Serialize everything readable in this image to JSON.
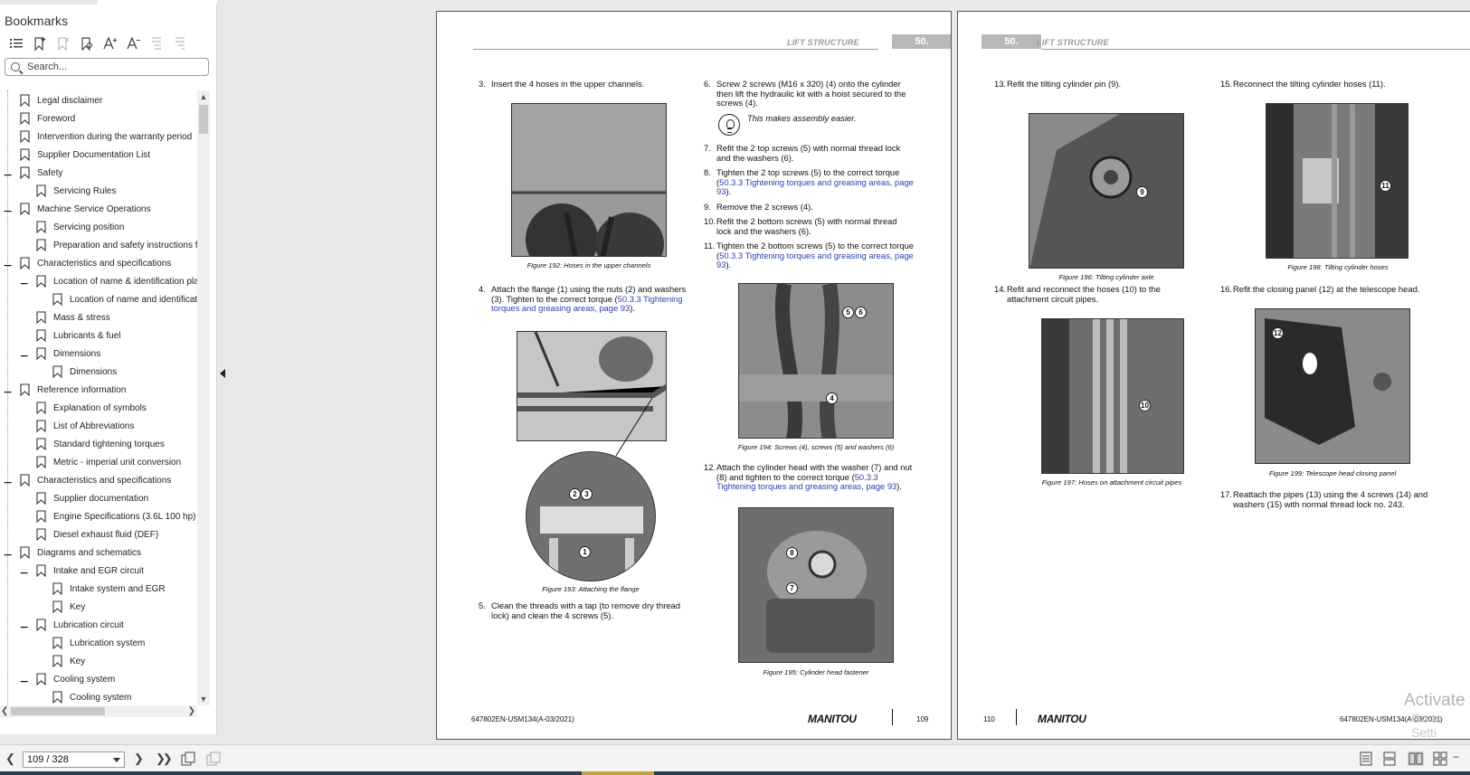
{
  "sidebar": {
    "title": "Bookmarks",
    "search_placeholder": "Search...",
    "tools": [
      "bookmark-options-icon",
      "add-bookmark-icon",
      "delete-bookmark-icon",
      "bookmark-properties-icon",
      "expand-text-icon",
      "shrink-text-icon",
      "expand-all-icon",
      "collapse-all-icon"
    ],
    "items": [
      {
        "label": "Legal disclaimer",
        "level": 0,
        "toggle": ""
      },
      {
        "label": "Foreword",
        "level": 0,
        "toggle": ""
      },
      {
        "label": "Intervention during the warranty period",
        "level": 0,
        "toggle": ""
      },
      {
        "label": "Supplier Documentation List",
        "level": 0,
        "toggle": ""
      },
      {
        "label": "Safety",
        "level": 0,
        "toggle": "−"
      },
      {
        "label": "Servicing Rules",
        "level": 1,
        "toggle": ""
      },
      {
        "label": "Machine Service Operations",
        "level": 0,
        "toggle": "−"
      },
      {
        "label": "Servicing position",
        "level": 1,
        "toggle": ""
      },
      {
        "label": "Preparation and safety instructions for",
        "level": 1,
        "toggle": ""
      },
      {
        "label": "Characteristics and specifications",
        "level": 0,
        "toggle": "−"
      },
      {
        "label": "Location of name & identification pla",
        "level": 1,
        "toggle": "−"
      },
      {
        "label": "Location of name and identificati",
        "level": 2,
        "toggle": ""
      },
      {
        "label": "Mass & stress",
        "level": 1,
        "toggle": ""
      },
      {
        "label": "Lubricants & fuel",
        "level": 1,
        "toggle": ""
      },
      {
        "label": "Dimensions",
        "level": 1,
        "toggle": "−"
      },
      {
        "label": "Dimensions",
        "level": 2,
        "toggle": ""
      },
      {
        "label": "Reference information",
        "level": 0,
        "toggle": "−"
      },
      {
        "label": "Explanation of symbols",
        "level": 1,
        "toggle": ""
      },
      {
        "label": "List of Abbreviations",
        "level": 1,
        "toggle": ""
      },
      {
        "label": "Standard tightening torques",
        "level": 1,
        "toggle": ""
      },
      {
        "label": "Metric - imperial unit conversion",
        "level": 1,
        "toggle": ""
      },
      {
        "label": "Characteristics and specifications",
        "level": 0,
        "toggle": "−"
      },
      {
        "label": "Supplier documentation",
        "level": 1,
        "toggle": ""
      },
      {
        "label": "Engine Specifications (3.6L 100 hp)",
        "level": 1,
        "toggle": ""
      },
      {
        "label": "Diesel exhaust fluid (DEF)",
        "level": 1,
        "toggle": ""
      },
      {
        "label": "Diagrams and schematics",
        "level": 0,
        "toggle": "−"
      },
      {
        "label": "Intake and EGR circuit",
        "level": 1,
        "toggle": "−"
      },
      {
        "label": "Intake system and EGR",
        "level": 2,
        "toggle": ""
      },
      {
        "label": "Key",
        "level": 2,
        "toggle": ""
      },
      {
        "label": "Lubrication circuit",
        "level": 1,
        "toggle": "−"
      },
      {
        "label": "Lubrication system",
        "level": 2,
        "toggle": ""
      },
      {
        "label": "Key",
        "level": 2,
        "toggle": ""
      },
      {
        "label": "Cooling system",
        "level": 1,
        "toggle": "−"
      },
      {
        "label": "Cooling system",
        "level": 2,
        "toggle": ""
      },
      {
        "label": "Key",
        "level": 2,
        "toggle": ""
      }
    ]
  },
  "page_left": {
    "header_section": "LIFT STRUCTURE",
    "header_number": "50.",
    "steps": {
      "s3_num": "3.",
      "s3_text": "Insert the 4 hoses in the upper channels.",
      "s4_num": "4.",
      "s4_text": "Attach the flange (1) using the nuts (2) and washers (3). Tighten to the correct torque (",
      "s4_link": "50.3.3 Tightening torques and greasing areas, page 93",
      "s4_tail": ").",
      "s5_num": "5.",
      "s5_text": "Clean the threads with a tap (to remove dry thread lock) and clean the 4 screws (5).",
      "s6_num": "6.",
      "s6_text": "Screw 2 screws (M16 x 320) (4) onto the cylinder then lift the hydraulic kit with a hoist secured to the screws (4).",
      "s6_note": "This makes assembly easier.",
      "s7_num": "7.",
      "s7_text": "Refit the 2 top screws (5) with normal thread lock and the washers (6).",
      "s8_num": "8.",
      "s8_text": "Tighten the 2 top screws (5) to the correct torque (",
      "s8_link": "50.3.3 Tightening torques and greasing areas, page 93",
      "s8_tail": ").",
      "s9_num": "9.",
      "s9_text": "Remove the 2 screws (4).",
      "s10_num": "10.",
      "s10_text": "Refit the 2 bottom screws (5) with normal thread lock and the washers (6).",
      "s11_num": "11.",
      "s11_text": "Tighten the 2 bottom screws (5) to the correct torque (",
      "s11_link": "50.3.3 Tightening torques and greasing areas, page 93",
      "s11_tail": ").",
      "s12_num": "12.",
      "s12_text": "Attach the cylinder head with the washer (7) and nut (8) and tighten to the correct torque (",
      "s12_link": "50.3.3 Tightening torques and greasing areas, page 93",
      "s12_tail": ")."
    },
    "captions": {
      "f192": "Figure 192: Hoses in the upper channels",
      "f193": "Figure 193: Attaching the flange",
      "f194": "Figure 194: Screws (4), screws (5) and washers (6)",
      "f195": "Figure 195: Cylinder head fastener"
    },
    "callouts": {
      "c1": "1",
      "c2": "2",
      "c3": "3",
      "c4": "4",
      "c5": "5",
      "c6": "6",
      "c7": "7",
      "c8": "8"
    },
    "footer_code": "647802EN-USM134(A-03/2021)",
    "footer_logo": "MANITOU",
    "footer_page": "109"
  },
  "page_right": {
    "header_section": "LIFT STRUCTURE",
    "header_number": "50.",
    "steps": {
      "s13_num": "13.",
      "s13_text": "Refit the tilting cylinder pin (9).",
      "s14_num": "14.",
      "s14_text": "Refit and reconnect the hoses (10) to the attachment circuit pipes.",
      "s15_num": "15.",
      "s15_text": "Reconnect the tilting cylinder hoses (11).",
      "s16_num": "16.",
      "s16_text": "Refit the closing panel (12) at the telescope head.",
      "s17_num": "17.",
      "s17_text": "Reattach the pipes (13) using the 4 screws (14) and washers (15) with normal thread lock no. 243."
    },
    "captions": {
      "f196": "Figure 196: Tilting cylinder axle",
      "f197": "Figure 197: Hoses on attachment circuit pipes",
      "f198": "Figure 198: Tilting cylinder hoses",
      "f199": "Figure 199: Telescope head closing panel"
    },
    "callouts": {
      "c9": "9",
      "c10": "10",
      "c11": "11",
      "c12": "12"
    },
    "footer_page": "110",
    "footer_logo": "MANITOU",
    "footer_code": "647802EN-USM134(A-03/2021)"
  },
  "watermark": {
    "line1": "Activate",
    "line2": "Go to Setti"
  },
  "bottombar": {
    "page_indicator": "109 / 328",
    "icons": [
      "prev-page-icon",
      "next-page-icon",
      "last-page-icon",
      "copy-icon",
      "paste-icon",
      "single-page-view-icon",
      "continuous-view-icon",
      "two-page-view-icon",
      "two-page-continuous-view-icon"
    ]
  },
  "colors": {
    "link": "#2a40b5",
    "header_box": "#b8b8b8",
    "taskbar": "#2b3c55"
  }
}
